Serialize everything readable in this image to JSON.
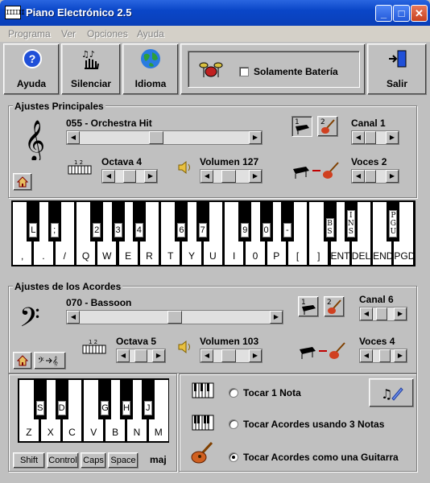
{
  "window": {
    "title": "Piano Electrónico 2.5",
    "icon_text": "IIIIII",
    "minimize": "_",
    "maximize": "□",
    "close": "✕"
  },
  "menu": [
    "Programa",
    "Ver",
    "Opciones",
    "Ayuda"
  ],
  "toolbar": {
    "help": "Ayuda",
    "silence": "Silenciar",
    "language": "Idioma",
    "drums_only": "Solamente Batería",
    "drums_checked": false,
    "exit": "Salir"
  },
  "main": {
    "title": "Ajustes Principales",
    "instrument": "055 - Orchestra Hit",
    "instrument_level": 0.45,
    "octave": "Octava 4",
    "octave_level": 0.5,
    "volume": "Volumen 127",
    "volume_level": 0.4,
    "channel": "Canal 1",
    "voices": "Voces 2",
    "mode_1": "1",
    "mode_2": "2",
    "white_keys": [
      ",",
      ".",
      "/",
      "Q",
      "W",
      "E",
      "R",
      "T",
      "Y",
      "U",
      "I",
      "0",
      "P",
      "[",
      "]",
      "ENT",
      "DEL",
      "END",
      "PGD"
    ],
    "black_keys": [
      {
        "label": "L",
        "after": 0
      },
      {
        "label": ";",
        "after": 1
      },
      {
        "label": "2",
        "after": 3
      },
      {
        "label": "3",
        "after": 4
      },
      {
        "label": "4",
        "after": 5
      },
      {
        "label": "6",
        "after": 7
      },
      {
        "label": "7",
        "after": 8
      },
      {
        "label": "9",
        "after": 10
      },
      {
        "label": "0",
        "after": 11
      },
      {
        "label": "-",
        "after": 12
      },
      {
        "label": "BS",
        "after": 14,
        "vertical": true
      },
      {
        "label": "INS",
        "after": 15,
        "vertical": true
      },
      {
        "label": "PGU",
        "after": 17,
        "vertical": true
      }
    ]
  },
  "chords": {
    "title": "Ajustes de los Acordes",
    "instrument": "070 - Bassoon",
    "instrument_level": 0.5,
    "octave": "Octava 5",
    "octave_level": 0.5,
    "volume": "Volumen 103",
    "volume_level": 0.4,
    "channel": "Canal 6",
    "voices": "Voces 4",
    "white_keys": [
      "Z",
      "X",
      "C",
      "V",
      "B",
      "N",
      "M"
    ],
    "black_keys": [
      {
        "label": "S",
        "after": 0
      },
      {
        "label": "D",
        "after": 1
      },
      {
        "label": "G",
        "after": 3
      },
      {
        "label": "H",
        "after": 4
      },
      {
        "label": "J",
        "after": 5
      }
    ],
    "modifiers": [
      "Shift",
      "Control",
      "Caps",
      "Space"
    ],
    "chord_type": "maj",
    "options": [
      "Tocar 1 Nota",
      "Tocar Acordes usando 3 Notas",
      "Tocar Acordes como una Guitarra"
    ],
    "selected_option": 2
  },
  "colors": {
    "titlebar": "#0a46c8",
    "face": "#c0c0c0"
  }
}
